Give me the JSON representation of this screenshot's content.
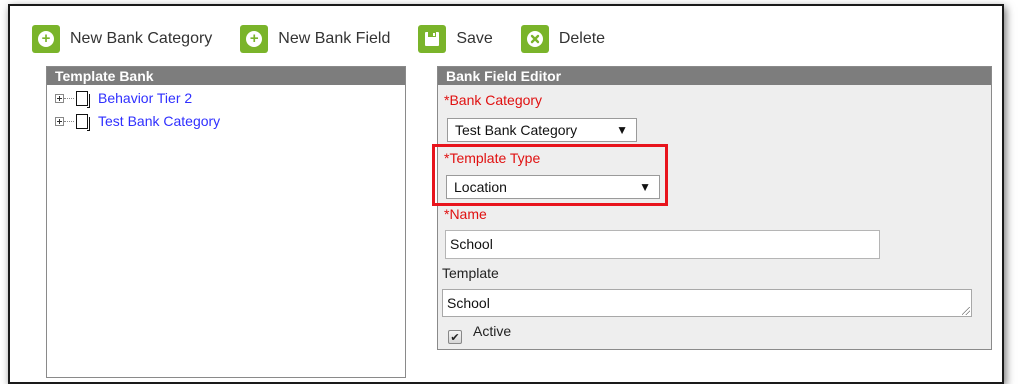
{
  "toolbar": {
    "new_category": "New Bank Category",
    "new_field": "New Bank Field",
    "save": "Save",
    "delete": "Delete"
  },
  "template_bank": {
    "title": "Template Bank",
    "items": [
      {
        "label": "Behavior Tier 2"
      },
      {
        "label": "Test Bank Category"
      }
    ]
  },
  "editor": {
    "title": "Bank Field Editor",
    "bank_category": {
      "label": "*Bank Category",
      "value": "Test Bank Category"
    },
    "template_type": {
      "label": "*Template Type",
      "value": "Location"
    },
    "name": {
      "label": "*Name",
      "value": "School"
    },
    "template": {
      "label": "Template",
      "value": "School"
    },
    "active": {
      "label": "Active",
      "checked": true
    }
  },
  "colors": {
    "toolbar_icon": "#7ab42a",
    "panel_header": "#7d7d7d",
    "required_label": "#e01010",
    "tree_link": "#2f2fff",
    "highlight_box": "#e8141c"
  }
}
